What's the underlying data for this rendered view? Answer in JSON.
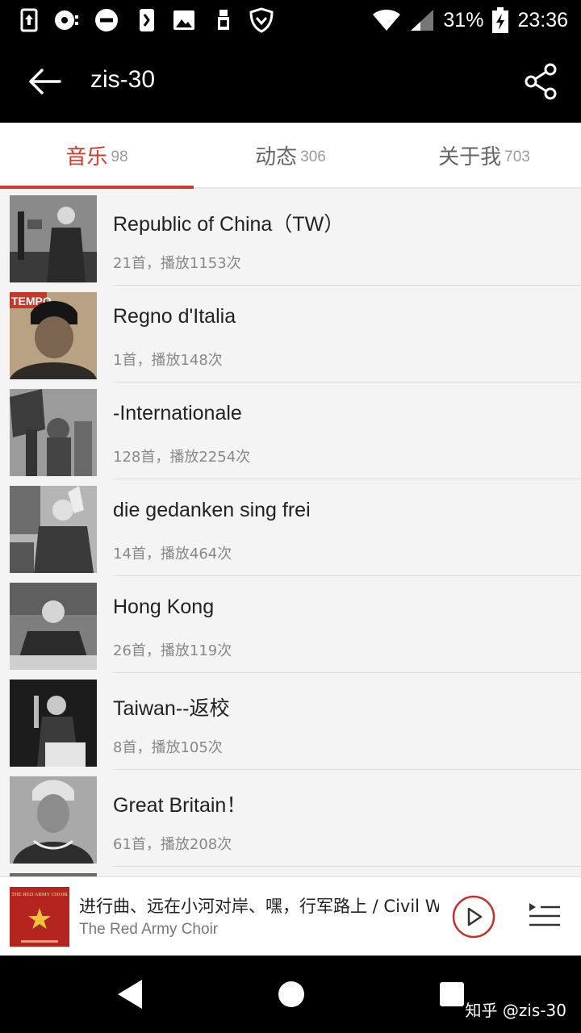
{
  "status_bar": {
    "battery_percent": "31%",
    "time": "23:36",
    "icons": [
      "usb-icon",
      "record-icon",
      "dnd-icon",
      "nfc-icon",
      "image-icon",
      "sim-icon",
      "shield-icon",
      "wifi-icon",
      "signal-icon",
      "battery-charging-icon"
    ]
  },
  "header": {
    "title": "zis-30",
    "back_icon": "arrow-left-icon",
    "share_icon": "share-icon"
  },
  "tabs": [
    {
      "label": "音乐",
      "count": "98",
      "active": true
    },
    {
      "label": "动态",
      "count": "306",
      "active": false
    },
    {
      "label": "关于我",
      "count": "703",
      "active": false
    }
  ],
  "playlists": [
    {
      "title": "Republic of China（TW）",
      "meta": "21首，播放1153次"
    },
    {
      "title": "Regno d'Italia",
      "meta": "1首，播放148次"
    },
    {
      "title": "-Internationale",
      "meta": "128首，播放2254次"
    },
    {
      "title": "die gedanken sing frei",
      "meta": "14首，播放464次"
    },
    {
      "title": "Hong Kong",
      "meta": "26首，播放119次"
    },
    {
      "title": "Taiwan--返校",
      "meta": "8首，播放105次"
    },
    {
      "title": "Great Britain！",
      "meta": "61首，播放208次"
    }
  ],
  "player": {
    "track": "进行曲、远在小河对岸、嘿，行军路上 / Civil W",
    "artist": "The Red Army Choir",
    "cover_label": "THE RED ARMY CHOIR",
    "accent": "#d33a31"
  },
  "watermark": "知乎 @zis-30"
}
